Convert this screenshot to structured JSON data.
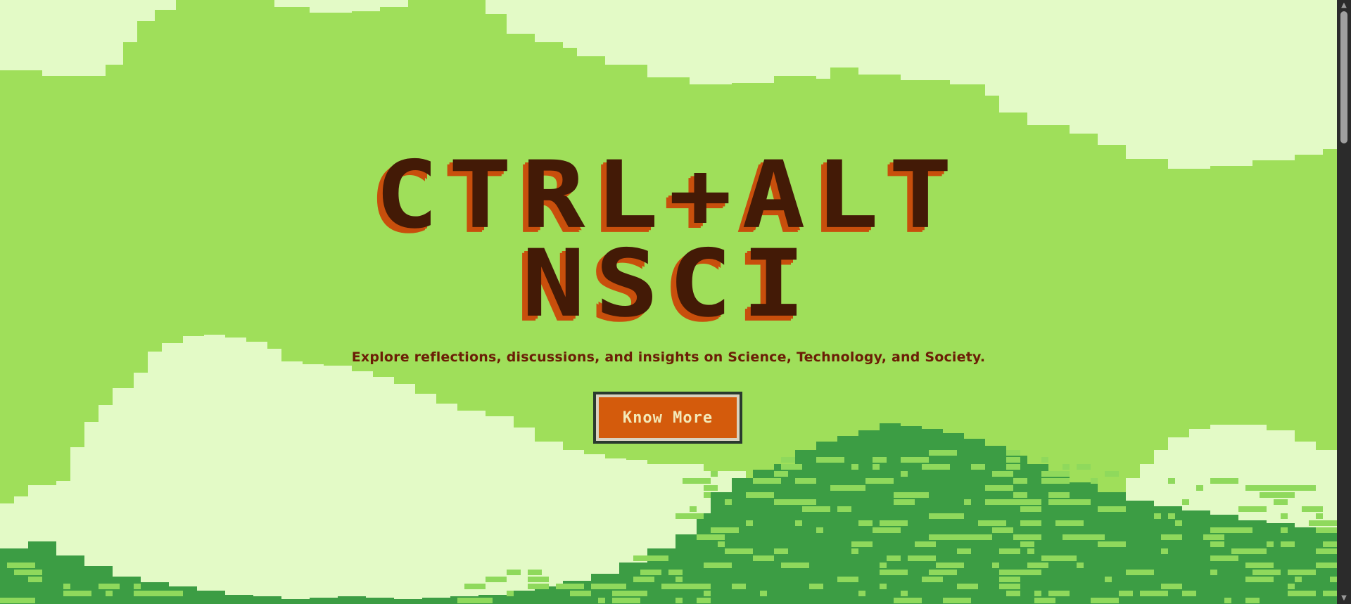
{
  "hero": {
    "title_line1": "CTRL+ALT",
    "title_line2": "NSCI",
    "subtitle": "Explore reflections, discussions, and insights on Science, Technology, and Society.",
    "cta_label": "Know More"
  },
  "colors": {
    "sky": "#9fdf5a",
    "cloud": "#e3fac6",
    "hill_dark": "#3c9d44",
    "hill_light": "#8fd95c",
    "title": "#431a06",
    "title_shadow": "#c84f0c",
    "button": "#d45b0c",
    "button_text": "#f3e9b8"
  },
  "scrollbar": {
    "up_icon": "triangle-up-icon",
    "down_icon": "triangle-down-icon"
  }
}
